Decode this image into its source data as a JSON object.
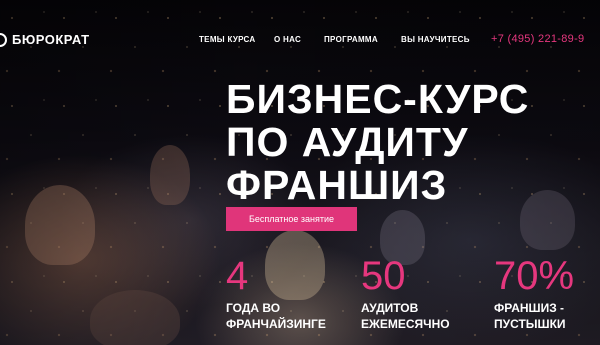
{
  "header": {
    "logo_text": "БЮРОКРАТ",
    "nav": [
      "ТЕМЫ КУРСА",
      "О НАС",
      "ПРОГРАММА",
      "ВЫ НАУЧИТЕСЬ"
    ],
    "phone": "+7 (495) 221-89-9"
  },
  "hero": {
    "title_lines": [
      "БИЗНЕС-КУРС",
      "ПО АУДИТУ",
      "ФРАНШИЗ"
    ],
    "cta_label": "Бесплатное занятие"
  },
  "stats": [
    {
      "value": "4",
      "label_lines": [
        "ГОДА ВО",
        "ФРАНЧАЙЗИНГЕ"
      ]
    },
    {
      "value": "50",
      "label_lines": [
        "АУДИТОВ",
        "ЕЖЕМЕСЯЧНО"
      ]
    },
    {
      "value": "70%",
      "label_lines": [
        "ФРАНШИЗ -",
        "ПУСТЫШКИ"
      ]
    }
  ],
  "colors": {
    "accent": "#e6377e",
    "button": "#e0357a",
    "text": "#ffffff"
  }
}
